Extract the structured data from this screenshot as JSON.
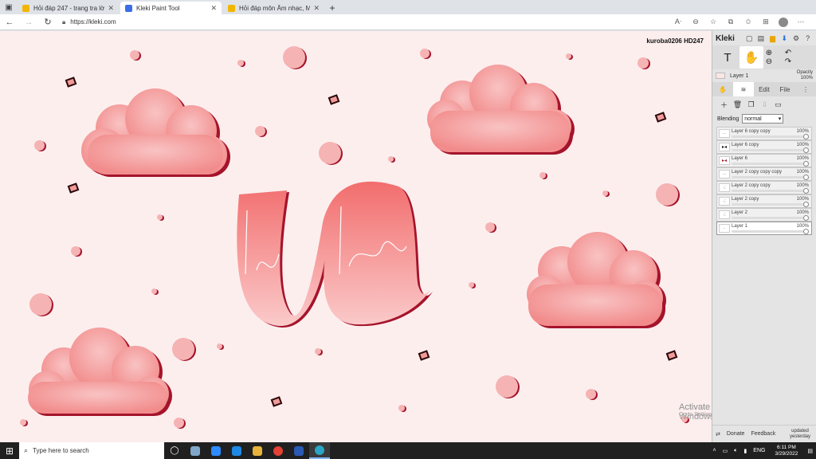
{
  "browser": {
    "tabs": [
      {
        "title": "Hỏi đáp 247 - trang tra lời",
        "favicon_color": "#f2b600",
        "active": false
      },
      {
        "title": "Kleki Paint Tool",
        "favicon_color": "#3a6ee8",
        "active": true
      },
      {
        "title": "Hỏi đáp môn Âm nhạc, Mỹ thuật",
        "favicon_color": "#f2b600",
        "active": false
      }
    ],
    "url": "https://kleki.com"
  },
  "canvas": {
    "signature": "kuroba0206 HD247",
    "background": "#fdeeee",
    "accent": "#a4142b"
  },
  "panel": {
    "brand": "Kleki",
    "current_layer": "Layer 1",
    "opacity_label": "Opacity",
    "opacity_value": "100%",
    "tab_edit": "Edit",
    "tab_file": "File",
    "blending_label": "Blending",
    "blending_value": "normal",
    "layers": [
      {
        "name": "Layer 6 copy copy",
        "opacity": "100%"
      },
      {
        "name": "Layer 6 copy",
        "opacity": "100%"
      },
      {
        "name": "Layer 6",
        "opacity": "100%"
      },
      {
        "name": "Layer 2 copy copy copy",
        "opacity": "100%"
      },
      {
        "name": "Layer 2 copy copy",
        "opacity": "100%"
      },
      {
        "name": "Layer 2 copy",
        "opacity": "100%"
      },
      {
        "name": "Layer 2",
        "opacity": "100%"
      },
      {
        "name": "Layer 1",
        "opacity": "100%"
      }
    ],
    "bottom": {
      "donate": "Donate",
      "feedback": "Feedback",
      "updated": "updated",
      "updated_when": "yesterday"
    }
  },
  "watermark": {
    "title": "Activate Windows",
    "subtitle": "Go to Settings to activate Windows."
  },
  "taskbar": {
    "search_placeholder": "Type here to search",
    "language": "ENG",
    "time": "6:11 PM",
    "date": "3/29/2022"
  }
}
